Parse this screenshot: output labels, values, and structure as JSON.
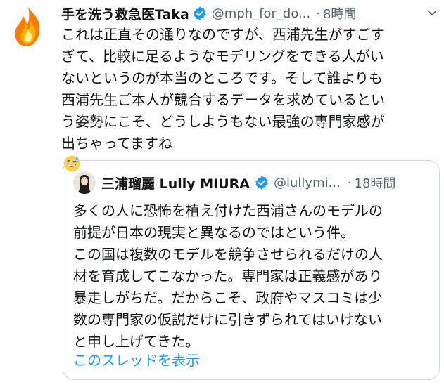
{
  "tweet": {
    "author_name": "手を洗う救急医Taka",
    "handle": "@mph_for_do...",
    "separator": "·",
    "time": "8時間",
    "text_lines": [
      "これは正直その通りなのですが、西浦先生がすごす",
      "ぎて、比較に足るようなモデリングをできる人がい",
      "ないというのが本当のところです。そして誰よりも",
      "西浦先生ご本人が競合するデータを求めているとい",
      "う姿勢にこそ、どうしようもない最強の専門家感が",
      "出ちゃってますね"
    ],
    "verified_icon": "verified-badge-icon",
    "emoji": "grinning-sweat-emoji",
    "accent_color": "#1d9bf0"
  },
  "quoted_tweet": {
    "author_name": "三浦瑠麗 Lully MIURA",
    "handle": "@lullymi...",
    "separator": "·",
    "time": "18時間",
    "text_lines": [
      "多くの人に恐怖を植え付けた西浦さんのモデルの",
      "前提が日本の現実と異なるのではという件。",
      "この国は複数のモデルを競争させられるだけの人",
      "材を育成してこなかった。専門家は正義感があり",
      "暴走しがちだ。だからこそ、政府やマスコミは少",
      "数の専門家の仮説だけに引きずられてはいけない",
      "と申し上げてきた。"
    ],
    "show_thread": "このスレッドを表示"
  }
}
